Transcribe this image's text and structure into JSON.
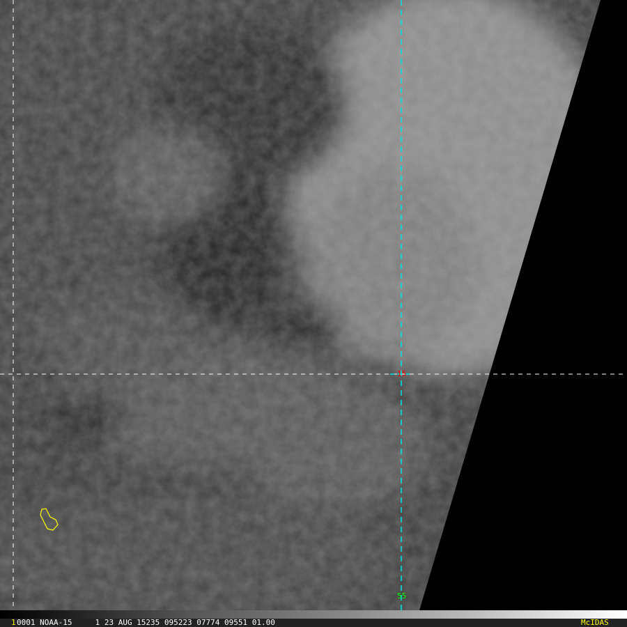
{
  "image": {
    "frame_number": "1",
    "info_line": "0001 NOAA-15     1 23 AUG 15235 095223 07774 09551 01.00",
    "brand": "McIDAS",
    "latitude_label": "15",
    "longitude_label": "55"
  },
  "colors": {
    "latlon_line": "#00e5e5",
    "grid_line": "#ffffff",
    "latitude_label": "#ff0000",
    "longitude_label": "#00ff00",
    "coastline": "#ffff00",
    "brand": "#ffff00"
  }
}
